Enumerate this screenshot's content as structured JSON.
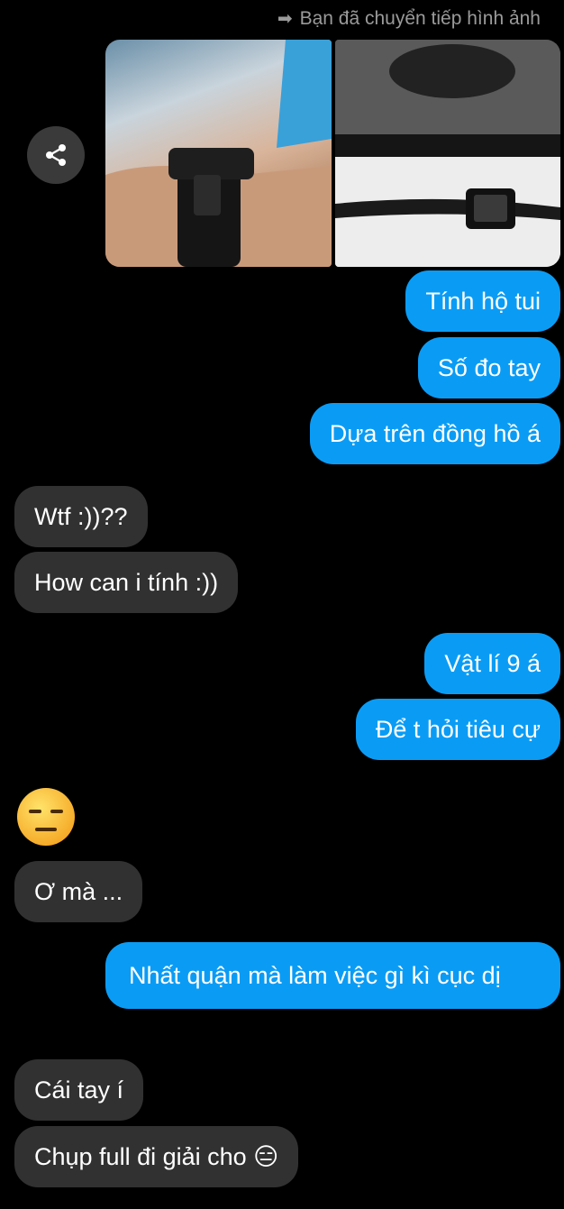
{
  "forward_note": "Bạn đã chuyển tiếp hình ảnh",
  "icons": {
    "forward": "forward-arrow-icon",
    "share": "share-icon",
    "emoji": "expressionless-face-icon"
  },
  "colors": {
    "outgoing_bubble": "#0a9cf5",
    "incoming_bubble": "#313131",
    "background": "#000000"
  },
  "messages": [
    {
      "direction": "out",
      "text": "Tính hộ tui"
    },
    {
      "direction": "out",
      "text": "Số đo tay"
    },
    {
      "direction": "out",
      "text": "Dựa trên đồng hồ á"
    },
    {
      "direction": "in",
      "text": "Wtf :))??"
    },
    {
      "direction": "in",
      "text": "How can i tính :))"
    },
    {
      "direction": "out",
      "text": "Vật lí 9 á"
    },
    {
      "direction": "out",
      "text": "Để t hỏi tiêu cự"
    },
    {
      "direction": "in",
      "text": "😑"
    },
    {
      "direction": "in",
      "text": "Ơ mà ..."
    },
    {
      "direction": "out",
      "text": "Nhất quận mà làm việc gì kì cục dị"
    },
    {
      "direction": "in",
      "text": "Cái tay í"
    },
    {
      "direction": "in",
      "text": "Chụp full đi giải cho 😑"
    }
  ]
}
